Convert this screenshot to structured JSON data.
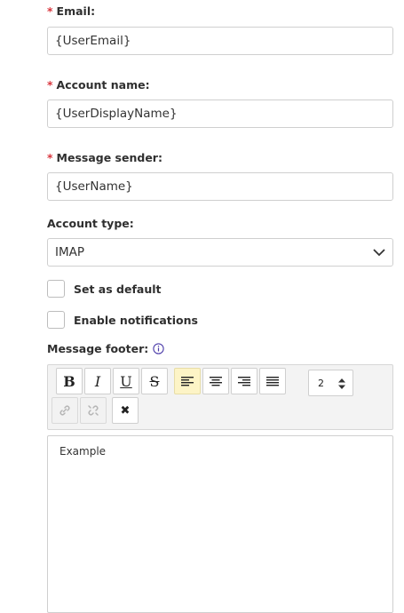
{
  "form": {
    "email": {
      "label": "Email:",
      "required_mark": "*",
      "value": "{UserEmail}"
    },
    "account_name": {
      "label": "Account name:",
      "required_mark": "*",
      "value": "{UserDisplayName}"
    },
    "message_sender": {
      "label": "Message sender:",
      "required_mark": "*",
      "value": "{UserName}"
    },
    "account_type": {
      "label": "Account type:",
      "value": "IMAP"
    },
    "set_default": {
      "label": "Set as default",
      "checked": false
    },
    "enable_notifications": {
      "label": "Enable notifications",
      "checked": false
    },
    "message_footer": {
      "label": "Message footer:",
      "info_icon": "info-icon"
    }
  },
  "toolbar": {
    "bold": "B",
    "italic": "I",
    "underline": "U",
    "strike": "S",
    "font_size": "2",
    "clear_format": "✖",
    "active_button": "align-left"
  },
  "editor": {
    "content": "Example"
  },
  "colors": {
    "required": "#d9363e",
    "active_button_bg": "#fdf4c6",
    "info_icon": "#4a3aa8"
  }
}
